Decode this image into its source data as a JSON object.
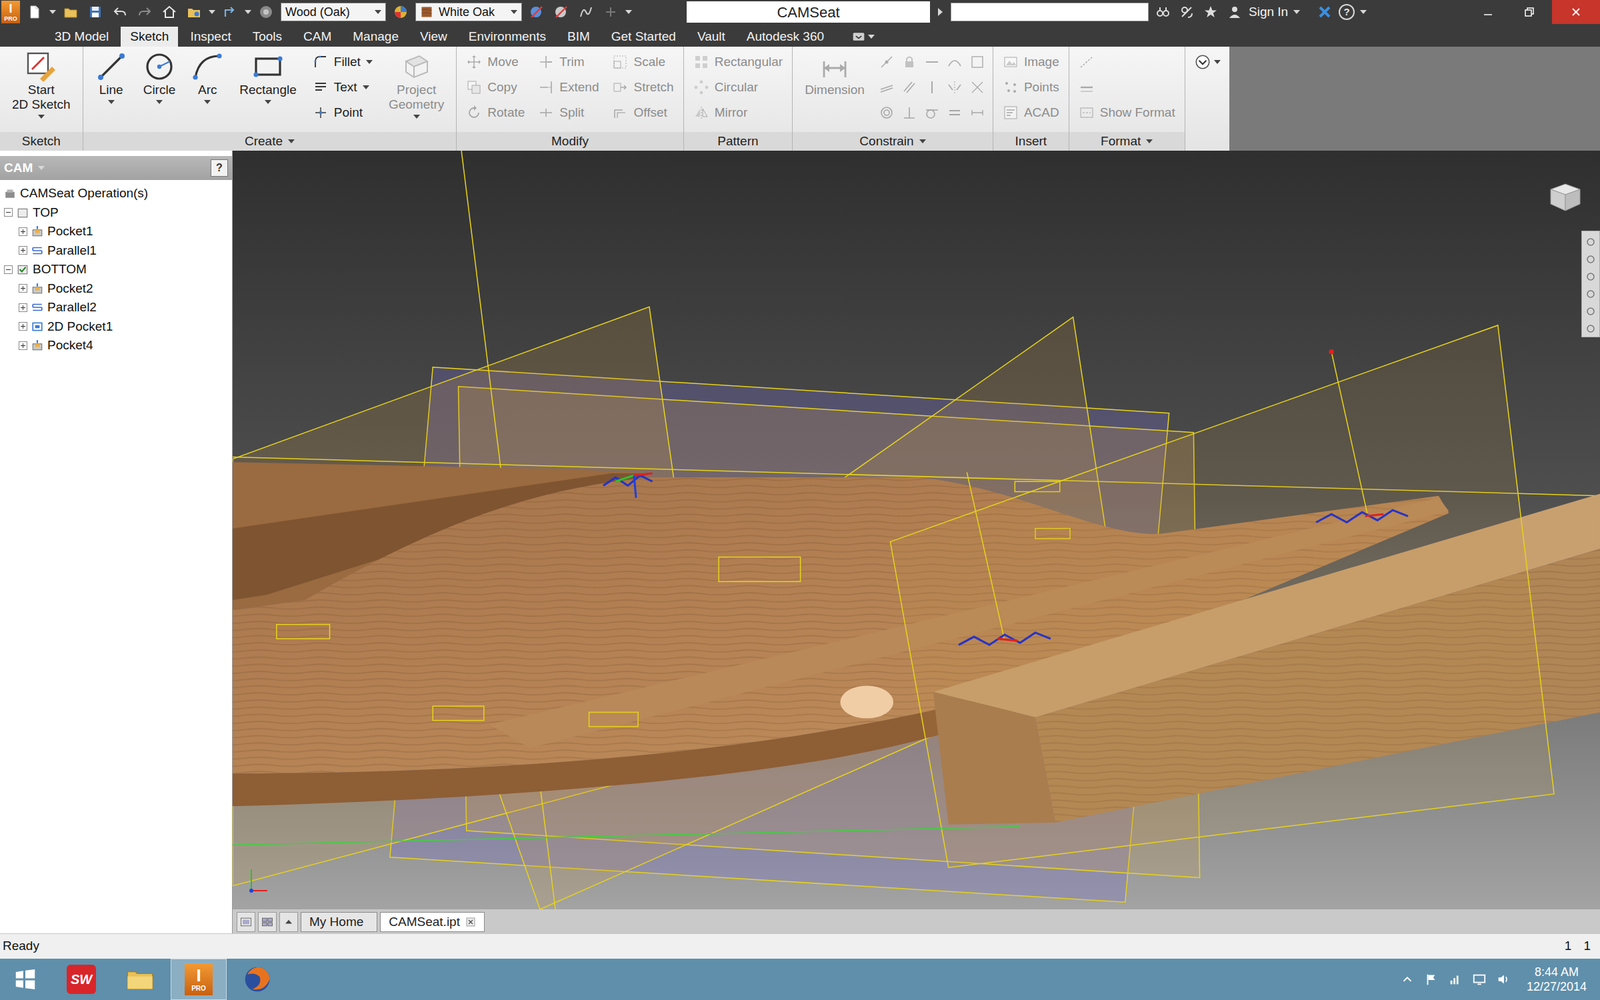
{
  "window": {
    "title": "CAMSeat",
    "app_icon": {
      "letter": "I",
      "edition": "PRO"
    }
  },
  "quick_access": {
    "material": "Wood (Oak)",
    "appearance": "White Oak",
    "search_value": "",
    "sign_in": "Sign In",
    "help": "?"
  },
  "tabs": [
    {
      "label": "3D Model",
      "selected": false
    },
    {
      "label": "Sketch",
      "selected": true
    },
    {
      "label": "Inspect",
      "selected": false
    },
    {
      "label": "Tools",
      "selected": false
    },
    {
      "label": "CAM",
      "selected": false
    },
    {
      "label": "Manage",
      "selected": false
    },
    {
      "label": "View",
      "selected": false
    },
    {
      "label": "Environments",
      "selected": false
    },
    {
      "label": "BIM",
      "selected": false
    },
    {
      "label": "Get Started",
      "selected": false
    },
    {
      "label": "Vault",
      "selected": false
    },
    {
      "label": "Autodesk 360",
      "selected": false
    }
  ],
  "ribbon": {
    "groups": [
      {
        "label": "Sketch",
        "menu": false,
        "columns": [
          {
            "kind": "large",
            "items": [
              {
                "lines": [
                  "Start",
                  "2D Sketch"
                ],
                "disabled": false,
                "dropdown": true
              }
            ]
          }
        ]
      },
      {
        "label": "Create",
        "menu": true,
        "columns": [
          {
            "kind": "large",
            "items": [
              {
                "lines": [
                  "Line"
                ],
                "disabled": false,
                "dropdown": true
              },
              {
                "lines": [
                  "Circle"
                ],
                "disabled": false,
                "dropdown": true
              },
              {
                "lines": [
                  "Arc"
                ],
                "disabled": false,
                "dropdown": true
              },
              {
                "lines": [
                  "Rectangle"
                ],
                "disabled": false,
                "dropdown": true
              }
            ]
          },
          {
            "kind": "small",
            "items": [
              {
                "lines": [
                  "Fillet"
                ],
                "disabled": false,
                "dropdown": true
              },
              {
                "lines": [
                  "Text"
                ],
                "disabled": false,
                "dropdown": true
              },
              {
                "lines": [
                  "Point"
                ],
                "disabled": false,
                "dropdown": false
              }
            ]
          },
          {
            "kind": "large",
            "items": [
              {
                "lines": [
                  "Project",
                  "Geometry"
                ],
                "disabled": true,
                "dropdown": true
              }
            ]
          }
        ]
      },
      {
        "label": "Modify",
        "menu": false,
        "columns": [
          {
            "kind": "small",
            "items": [
              {
                "lines": [
                  "Move"
                ],
                "disabled": true,
                "dropdown": false
              },
              {
                "lines": [
                  "Copy"
                ],
                "disabled": true,
                "dropdown": false
              },
              {
                "lines": [
                  "Rotate"
                ],
                "disabled": true,
                "dropdown": false
              }
            ]
          },
          {
            "kind": "small",
            "items": [
              {
                "lines": [
                  "Trim"
                ],
                "disabled": true,
                "dropdown": false
              },
              {
                "lines": [
                  "Extend"
                ],
                "disabled": true,
                "dropdown": false
              },
              {
                "lines": [
                  "Split"
                ],
                "disabled": true,
                "dropdown": false
              }
            ]
          },
          {
            "kind": "small",
            "items": [
              {
                "lines": [
                  "Scale"
                ],
                "disabled": true,
                "dropdown": false
              },
              {
                "lines": [
                  "Stretch"
                ],
                "disabled": true,
                "dropdown": false
              },
              {
                "lines": [
                  "Offset"
                ],
                "disabled": true,
                "dropdown": false
              }
            ]
          }
        ]
      },
      {
        "label": "Pattern",
        "menu": false,
        "columns": [
          {
            "kind": "small",
            "items": [
              {
                "lines": [
                  "Rectangular"
                ],
                "disabled": true,
                "dropdown": false
              },
              {
                "lines": [
                  "Circular"
                ],
                "disabled": true,
                "dropdown": false
              },
              {
                "lines": [
                  "Mirror"
                ],
                "disabled": true,
                "dropdown": false
              }
            ]
          }
        ]
      },
      {
        "label": "Constrain",
        "menu": true,
        "columns": [
          {
            "kind": "large",
            "items": [
              {
                "lines": [
                  "Dimension"
                ],
                "disabled": true,
                "dropdown": false
              }
            ]
          },
          {
            "kind": "icons",
            "items": [
              {
                "disabled": true
              },
              {
                "disabled": true
              },
              {
                "disabled": true
              },
              {
                "disabled": true
              },
              {
                "disabled": true
              },
              {
                "disabled": true
              },
              {
                "disabled": true
              },
              {
                "disabled": true
              },
              {
                "disabled": true
              },
              {
                "disabled": true
              },
              {
                "disabled": true
              },
              {
                "disabled": true
              },
              {
                "disabled": true
              },
              {
                "disabled": true
              },
              {
                "disabled": true
              }
            ]
          }
        ]
      },
      {
        "label": "Insert",
        "menu": false,
        "columns": [
          {
            "kind": "small",
            "items": [
              {
                "lines": [
                  "Image"
                ],
                "disabled": true,
                "dropdown": false
              },
              {
                "lines": [
                  "Points"
                ],
                "disabled": true,
                "dropdown": false
              },
              {
                "lines": [
                  "ACAD"
                ],
                "disabled": true,
                "dropdown": false
              }
            ]
          }
        ]
      },
      {
        "label": "Format",
        "menu": true,
        "columns": [
          {
            "kind": "small",
            "items": [
              {
                "lines": [],
                "disabled": true,
                "dropdown": false
              },
              {
                "lines": [],
                "disabled": true,
                "dropdown": false
              },
              {
                "lines": [
                  "Show Format"
                ],
                "disabled": true,
                "dropdown": false
              }
            ]
          }
        ]
      }
    ]
  },
  "browser": {
    "title": "CAM",
    "help": "?",
    "items": [
      {
        "label": "CAMSeat Operation(s)",
        "kind": "root",
        "level": 0
      },
      {
        "label": "TOP",
        "kind": "setup",
        "level": 0,
        "expanded": true,
        "active": false
      },
      {
        "label": "Pocket1",
        "kind": "pocket",
        "level": 1,
        "expanded": false
      },
      {
        "label": "Parallel1",
        "kind": "parallel",
        "level": 1,
        "expanded": false
      },
      {
        "label": "BOTTOM",
        "kind": "setup",
        "level": 0,
        "expanded": true,
        "active": true
      },
      {
        "label": "Pocket2",
        "kind": "pocket",
        "level": 1,
        "expanded": false
      },
      {
        "label": "Parallel2",
        "kind": "parallel",
        "level": 1,
        "expanded": false
      },
      {
        "label": "2D Pocket1",
        "kind": "pocket2d",
        "level": 1,
        "expanded": false
      },
      {
        "label": "Pocket4",
        "kind": "pocket",
        "level": 1,
        "expanded": false
      }
    ]
  },
  "document_tabs": [
    {
      "label": "My Home",
      "selected": false,
      "closable": false
    },
    {
      "label": "CAMSeat.ipt",
      "selected": true,
      "closable": true
    }
  ],
  "status_bar": {
    "message": "Ready",
    "values": [
      "1",
      "1"
    ]
  },
  "taskbar": {
    "apps": [
      {
        "kind": "solidworks",
        "glyph": "SW",
        "active": false
      },
      {
        "kind": "explorer",
        "active": false
      },
      {
        "kind": "inventor",
        "glyph": "I",
        "edition": "PRO",
        "active": true
      },
      {
        "kind": "firefox",
        "active": false
      }
    ],
    "clock": {
      "time": "8:44 AM",
      "date": "12/27/2014"
    }
  }
}
